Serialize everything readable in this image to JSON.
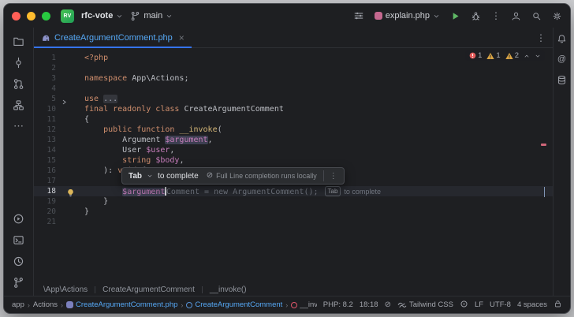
{
  "colors": {
    "accent": "#3574f0",
    "error": "#e35d5d",
    "warning": "#d9a444",
    "modified_file": "#56a8f5",
    "keyword": "#cf8e6d",
    "variable": "#c77dbb",
    "ghost_text": "#70757f",
    "project_badge_green": "#2f9e57"
  },
  "icons": {
    "close": "×",
    "kebab": "⋮",
    "more": "⋯",
    "at": "@",
    "chevron": "∨",
    "nav_sep": "›",
    "offline": "⊘"
  },
  "titlebar": {
    "project_badge": "RV",
    "project_name": "rfc-vote",
    "branch": "main",
    "run_config": "explain.php"
  },
  "tabs": {
    "active": {
      "name": "CreateArgumentComment.php"
    }
  },
  "inspections": {
    "error_count": "1",
    "warning_count": "1",
    "weak_count": "2"
  },
  "completion_popup": {
    "key": "Tab",
    "action": "to complete",
    "note": "Full Line completion runs locally"
  },
  "editor": {
    "lines": [
      {
        "n": "1",
        "segs": [
          {
            "t": "<?php",
            "c": "kw"
          }
        ]
      },
      {
        "n": "2",
        "segs": []
      },
      {
        "n": "3",
        "segs": [
          {
            "t": "namespace ",
            "c": "kw"
          },
          {
            "t": "App\\Actions;",
            "c": "pl"
          }
        ]
      },
      {
        "n": "4",
        "segs": []
      },
      {
        "n": "5",
        "fold": true,
        "segs": [
          {
            "t": "use ",
            "c": "kw"
          },
          {
            "t": "...",
            "c": "fold"
          }
        ]
      },
      {
        "n": "10",
        "segs": [
          {
            "t": "final readonly class ",
            "c": "kw"
          },
          {
            "t": "CreateArgumentComment",
            "c": "pl"
          }
        ]
      },
      {
        "n": "11",
        "segs": [
          {
            "t": "{",
            "c": "pl"
          }
        ]
      },
      {
        "n": "12",
        "segs": [
          {
            "t": "    ",
            "c": "pl"
          },
          {
            "t": "public function ",
            "c": "kw"
          },
          {
            "t": "__invoke",
            "c": "fn"
          },
          {
            "t": "(",
            "c": "pl"
          }
        ]
      },
      {
        "n": "13",
        "segs": [
          {
            "t": "        ",
            "c": "pl"
          },
          {
            "t": "Argument ",
            "c": "pl"
          },
          {
            "t": "$argument",
            "c": "varhl"
          },
          {
            "t": ",",
            "c": "pl"
          }
        ]
      },
      {
        "n": "14",
        "segs": [
          {
            "t": "        ",
            "c": "pl"
          },
          {
            "t": "User ",
            "c": "pl"
          },
          {
            "t": "$user",
            "c": "var"
          },
          {
            "t": ",",
            "c": "pl"
          }
        ]
      },
      {
        "n": "15",
        "segs": [
          {
            "t": "        ",
            "c": "pl"
          },
          {
            "t": "string ",
            "c": "kw"
          },
          {
            "t": "$body",
            "c": "var"
          },
          {
            "t": ",",
            "c": "pl"
          }
        ]
      },
      {
        "n": "16",
        "segs": [
          {
            "t": "    ): ",
            "c": "pl"
          },
          {
            "t": "void",
            "c": "kw"
          },
          {
            "t": " {",
            "c": "pl"
          }
        ]
      },
      {
        "n": "17",
        "segs": []
      },
      {
        "n": "18",
        "current": true,
        "bulb": true,
        "segs": [
          {
            "t": "        ",
            "c": "pl"
          },
          {
            "t": "$argument",
            "c": "varhl",
            "caret": true
          },
          {
            "t": "Comment = new ArgumentComment();",
            "c": "ghost"
          },
          {
            "t": "Tab",
            "c": "key"
          },
          {
            "t": "to complete",
            "c": "hint"
          }
        ]
      },
      {
        "n": "19",
        "segs": [
          {
            "t": "    }",
            "c": "pl"
          }
        ]
      },
      {
        "n": "20",
        "segs": [
          {
            "t": "}",
            "c": "pl"
          }
        ]
      },
      {
        "n": "21",
        "segs": []
      }
    ]
  },
  "breadcrumbs": {
    "items": [
      "\\App\\Actions",
      "CreateArgumentComment",
      "__invoke()"
    ]
  },
  "statusbar": {
    "nav": [
      {
        "label": "app"
      },
      {
        "label": "Actions"
      },
      {
        "label": "CreateArgumentComment.php",
        "icon": "php-file",
        "modified": true
      },
      {
        "label": "CreateArgumentComment",
        "icon": "class",
        "modified": true
      },
      {
        "label": "__invoke",
        "icon": "method"
      }
    ],
    "php_version": "PHP: 8.2",
    "caret": "18:18",
    "tailwind": "Tailwind CSS",
    "line_ending": "LF",
    "encoding": "UTF-8",
    "indent": "4 spaces"
  }
}
